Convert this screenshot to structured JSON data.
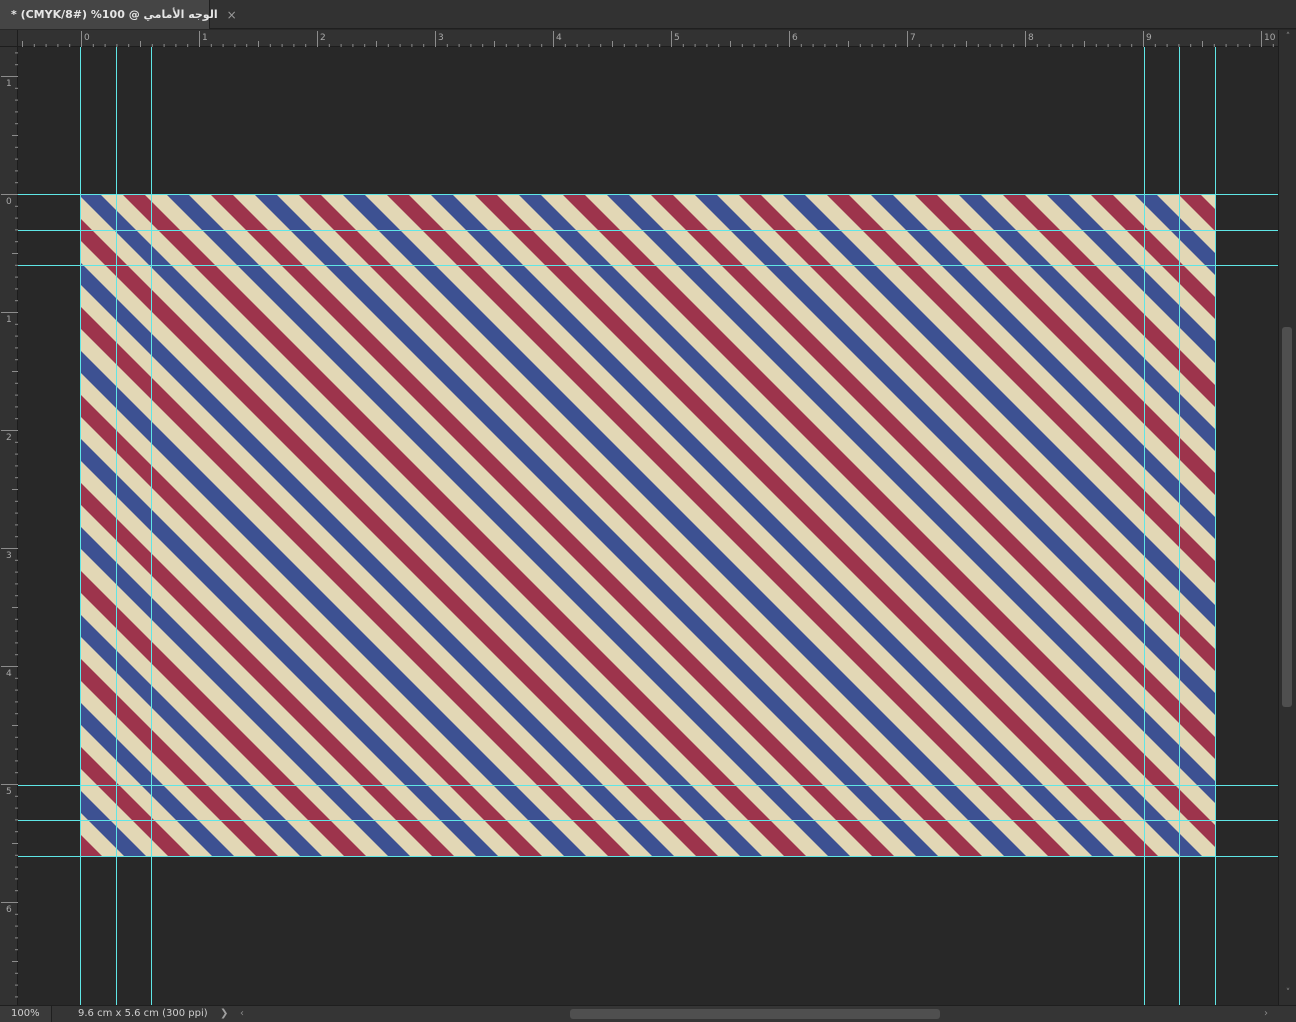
{
  "document_tab": {
    "title": "الوجه الأمامي @ 100% (CMYK/8#) *",
    "close_glyph": "×"
  },
  "rulers": {
    "horizontal_ticks": [
      "0",
      "1",
      "2",
      "3",
      "4",
      "5",
      "6",
      "7",
      "8",
      "9",
      "10"
    ],
    "vertical_ticks": [
      "1",
      "0",
      "1",
      "2",
      "3",
      "4",
      "5",
      "6"
    ]
  },
  "artwork": {
    "stripe_colors": {
      "cream": "#e2d7b5",
      "red": "#9d344c",
      "blue": "#3d5192"
    },
    "guide_color": "#5fe6e6"
  },
  "status_bar": {
    "zoom": "100%",
    "document_info": "9.6 cm x 5.6 cm (300 ppi)",
    "expand_glyph": "❯"
  },
  "icons": {
    "scroll_left": "‹",
    "scroll_right": "›",
    "scroll_up": "˄",
    "scroll_down": "˅"
  }
}
